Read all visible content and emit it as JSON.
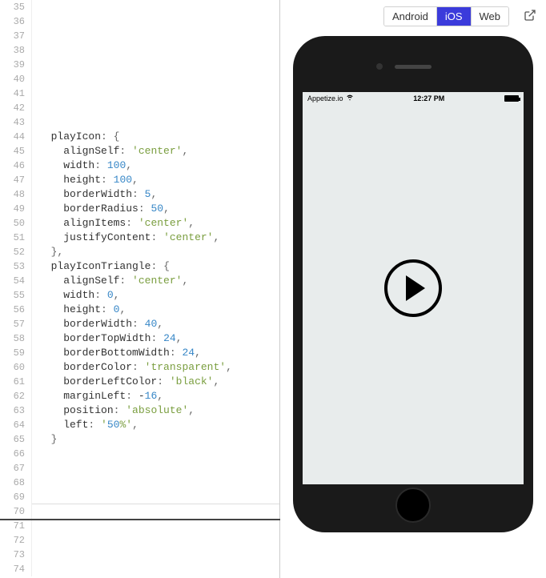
{
  "editor": {
    "lineStart": 35,
    "lineEnd": 74,
    "lines": [
      "",
      "",
      "",
      "",
      "",
      "",
      "",
      "",
      "",
      "  playIcon: {",
      "    alignSelf: 'center',",
      "    width: 100,",
      "    height: 100,",
      "    borderWidth: 5,",
      "    borderRadius: 50,",
      "    alignItems: 'center',",
      "    justifyContent: 'center',",
      "  },",
      "  playIconTriangle: {",
      "    alignSelf: 'center',",
      "    width: 0,",
      "    height: 0,",
      "    borderWidth: 40,",
      "    borderTopWidth: 24,",
      "    borderBottomWidth: 24,",
      "    borderColor: 'transparent',",
      "    borderLeftColor: 'black',",
      "    marginLeft: -16,",
      "    position: 'absolute',",
      "    left: '50%',",
      "  }",
      "",
      "",
      "",
      "",
      "",
      "",
      "",
      "",
      ""
    ]
  },
  "tabs": {
    "android": "Android",
    "ios": "iOS",
    "web": "Web",
    "active": "ios"
  },
  "phone": {
    "carrier": "Appetize.io",
    "time": "12:27 PM"
  }
}
